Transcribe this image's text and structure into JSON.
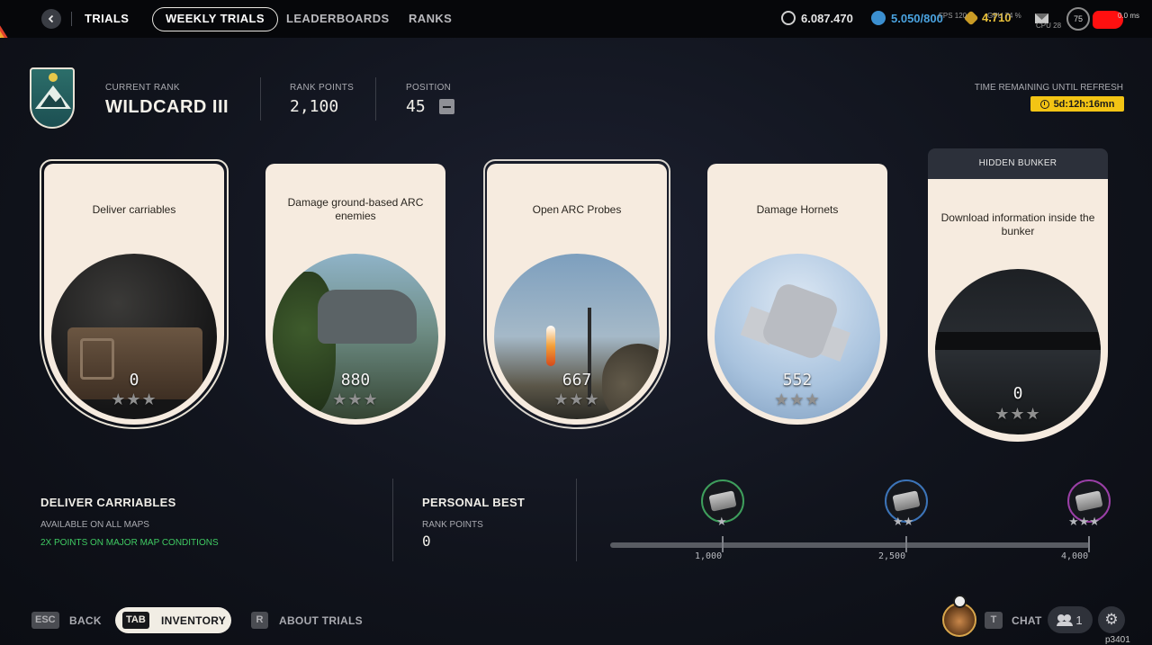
{
  "topbar": {
    "nav": {
      "trials": "TRIALS",
      "weekly_trials": "WEEKLY TRIALS",
      "leaderboards": "LEADERBOARDS",
      "ranks": "RANKS"
    },
    "currencies": {
      "coins": "6.087.470",
      "credits": "5.050/800",
      "tokens": "4.710"
    },
    "hud": {
      "fps": "FPS 120",
      "gpu": "GPU 74 %",
      "cpu": "CPU 28",
      "level": "75",
      "ping": "0.0 ms"
    }
  },
  "rank_header": {
    "current_rank_label": "CURRENT RANK",
    "current_rank": "WILDCARD III",
    "rank_points_label": "RANK POINTS",
    "rank_points": "2,100",
    "position_label": "POSITION",
    "position": "45",
    "timer_label": "TIME REMAINING UNTIL REFRESH",
    "timer": "5d:12h:16mn"
  },
  "trials": [
    {
      "title": "Deliver carriables",
      "score": "0",
      "stars": "★★★"
    },
    {
      "title": "Damage ground-based ARC enemies",
      "score": "880",
      "stars": "★★★"
    },
    {
      "title": "Open ARC Probes",
      "score": "667",
      "stars": "★★★"
    },
    {
      "title": "Damage Hornets",
      "score": "552",
      "stars": "★★★"
    },
    {
      "header": "HIDDEN BUNKER",
      "title": "Download information inside the bunker",
      "score": "0",
      "stars": "★★★"
    }
  ],
  "selected_trial": {
    "title": "DELIVER CARRIABLES",
    "maps": "AVAILABLE ON ALL MAPS",
    "bonus": "2X POINTS ON MAJOR MAP CONDITIONS"
  },
  "personal_best": {
    "title": "PERSONAL BEST",
    "label": "RANK POINTS",
    "value": "0"
  },
  "milestones": [
    {
      "points": "1,000",
      "stars": "★",
      "ring_color": "#3e9e5c"
    },
    {
      "points": "2,500",
      "stars": "★★",
      "ring_color": "#3c74b8"
    },
    {
      "points": "4,000",
      "stars": "★★★",
      "ring_color": "#9a3fa6"
    }
  ],
  "footer": {
    "back_key": "ESC",
    "back_label": "BACK",
    "inventory_key": "TAB",
    "inventory_label": "INVENTORY",
    "about_key": "R",
    "about_label": "ABOUT TRIALS",
    "chat_key": "T",
    "chat_label": "CHAT",
    "friends_count": "1",
    "build_id": "p3401"
  },
  "icons": {
    "back": "chevron-left-icon",
    "coins": "coin-icon",
    "credits": "credit-icon",
    "tokens": "token-icon",
    "mail": "mail-icon",
    "timer": "clock-icon",
    "friends": "people-icon",
    "settings": "gear-icon"
  },
  "colors": {
    "card_bg": "#f6ebdf",
    "timer_bg": "#f3c414",
    "bonus_green": "#3fca62"
  }
}
